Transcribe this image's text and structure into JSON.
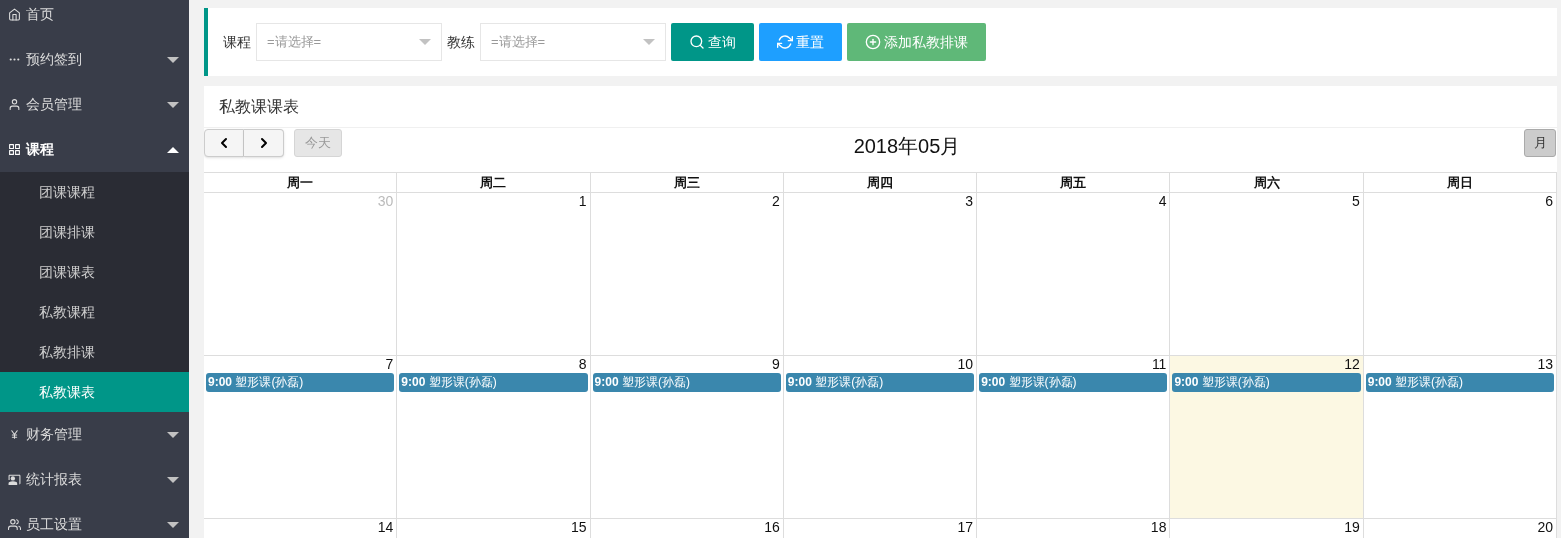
{
  "sidebar": {
    "items": [
      {
        "label": "首页",
        "expandable": false,
        "expanded": false,
        "selected": false
      },
      {
        "label": "预约签到",
        "expandable": true,
        "expanded": false,
        "selected": false
      },
      {
        "label": "会员管理",
        "expandable": true,
        "expanded": false,
        "selected": false
      },
      {
        "label": "课程",
        "expandable": true,
        "expanded": true,
        "selected": false,
        "children": [
          {
            "label": "团课课程",
            "selected": false
          },
          {
            "label": "团课排课",
            "selected": false
          },
          {
            "label": "团课课表",
            "selected": false
          },
          {
            "label": "私教课程",
            "selected": false
          },
          {
            "label": "私教排课",
            "selected": false
          },
          {
            "label": "私教课表",
            "selected": true
          }
        ]
      },
      {
        "label": "财务管理",
        "expandable": true,
        "expanded": false,
        "selected": false
      },
      {
        "label": "统计报表",
        "expandable": true,
        "expanded": false,
        "selected": false
      },
      {
        "label": "员工设置",
        "expandable": true,
        "expanded": false,
        "selected": false
      }
    ]
  },
  "filters": [
    {
      "label": "课程",
      "placeholder": "=请选择="
    },
    {
      "label": "教练",
      "placeholder": "=请选择="
    }
  ],
  "buttons": [
    {
      "label": "查询",
      "kind": "search"
    },
    {
      "label": "重置",
      "kind": "reset"
    },
    {
      "label": "添加私教排课",
      "kind": "add"
    }
  ],
  "calendar": {
    "title": "私教课课表",
    "today_button": "今天",
    "month": "2018年05月",
    "view_button": "月",
    "weekdays": [
      "周一",
      "周二",
      "周三",
      "周四",
      "周五",
      "周六",
      "周日"
    ],
    "weeks": [
      [
        {
          "date": "30",
          "other_month": true,
          "today": false
        },
        {
          "date": "1",
          "other_month": false,
          "today": false
        },
        {
          "date": "2",
          "other_month": false,
          "today": false
        },
        {
          "date": "3",
          "other_month": false,
          "today": false
        },
        {
          "date": "4",
          "other_month": false,
          "today": false
        },
        {
          "date": "5",
          "other_month": false,
          "today": false
        },
        {
          "date": "6",
          "other_month": false,
          "today": false
        }
      ],
      [
        {
          "date": "7",
          "other_month": false,
          "today": false,
          "events": [
            {
              "time": "9:00",
              "title": "塑形课(孙磊)"
            }
          ]
        },
        {
          "date": "8",
          "other_month": false,
          "today": false,
          "events": [
            {
              "time": "9:00",
              "title": "塑形课(孙磊)"
            }
          ]
        },
        {
          "date": "9",
          "other_month": false,
          "today": false,
          "events": [
            {
              "time": "9:00",
              "title": "塑形课(孙磊)"
            }
          ]
        },
        {
          "date": "10",
          "other_month": false,
          "today": false,
          "events": [
            {
              "time": "9:00",
              "title": "塑形课(孙磊)"
            }
          ]
        },
        {
          "date": "11",
          "other_month": false,
          "today": false,
          "events": [
            {
              "time": "9:00",
              "title": "塑形课(孙磊)"
            }
          ]
        },
        {
          "date": "12",
          "other_month": false,
          "today": true,
          "events": [
            {
              "time": "9:00",
              "title": "塑形课(孙磊)"
            }
          ]
        },
        {
          "date": "13",
          "other_month": false,
          "today": false,
          "events": [
            {
              "time": "9:00",
              "title": "塑形课(孙磊)"
            }
          ]
        }
      ],
      [
        {
          "date": "14",
          "other_month": false,
          "today": false
        },
        {
          "date": "15",
          "other_month": false,
          "today": false
        },
        {
          "date": "16",
          "other_month": false,
          "today": false
        },
        {
          "date": "17",
          "other_month": false,
          "today": false
        },
        {
          "date": "18",
          "other_month": false,
          "today": false
        },
        {
          "date": "19",
          "other_month": false,
          "today": false
        },
        {
          "date": "20",
          "other_month": false,
          "today": false
        }
      ]
    ]
  }
}
